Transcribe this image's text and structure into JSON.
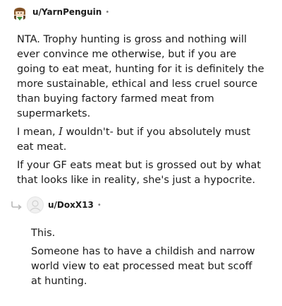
{
  "comments": [
    {
      "username": "u/YarnPenguin",
      "separator": "•",
      "avatar_icon": "anime-character-avatar-icon",
      "paragraphs": [
        "NTA. Trophy hunting is gross and nothing will ever convince me otherwise, but if you are going to eat meat, hunting for it is definitely the more sustainable, ethical and less cruel source than buying factory farmed meat from supermarkets.",
        {
          "before": "I mean, ",
          "emphasis": "I",
          "after": " wouldn't- but if you absolutely must eat meat."
        },
        "If your GF eats meat but is grossed out by what that looks like in reality, she's just a hypocrite."
      ]
    },
    {
      "username": "u/DoxX13",
      "separator": "•",
      "avatar_icon": "default-user-avatar-icon",
      "reply_icon": "reply-arrow-icon",
      "paragraphs": [
        "This.",
        "Someone has to have a childish and narrow world view to eat processed meat but scoff at hunting."
      ]
    }
  ],
  "colors": {
    "text": "#1c1c1c",
    "meta": "#7c7c7c",
    "reply_arrow": "#b8b8b8"
  }
}
